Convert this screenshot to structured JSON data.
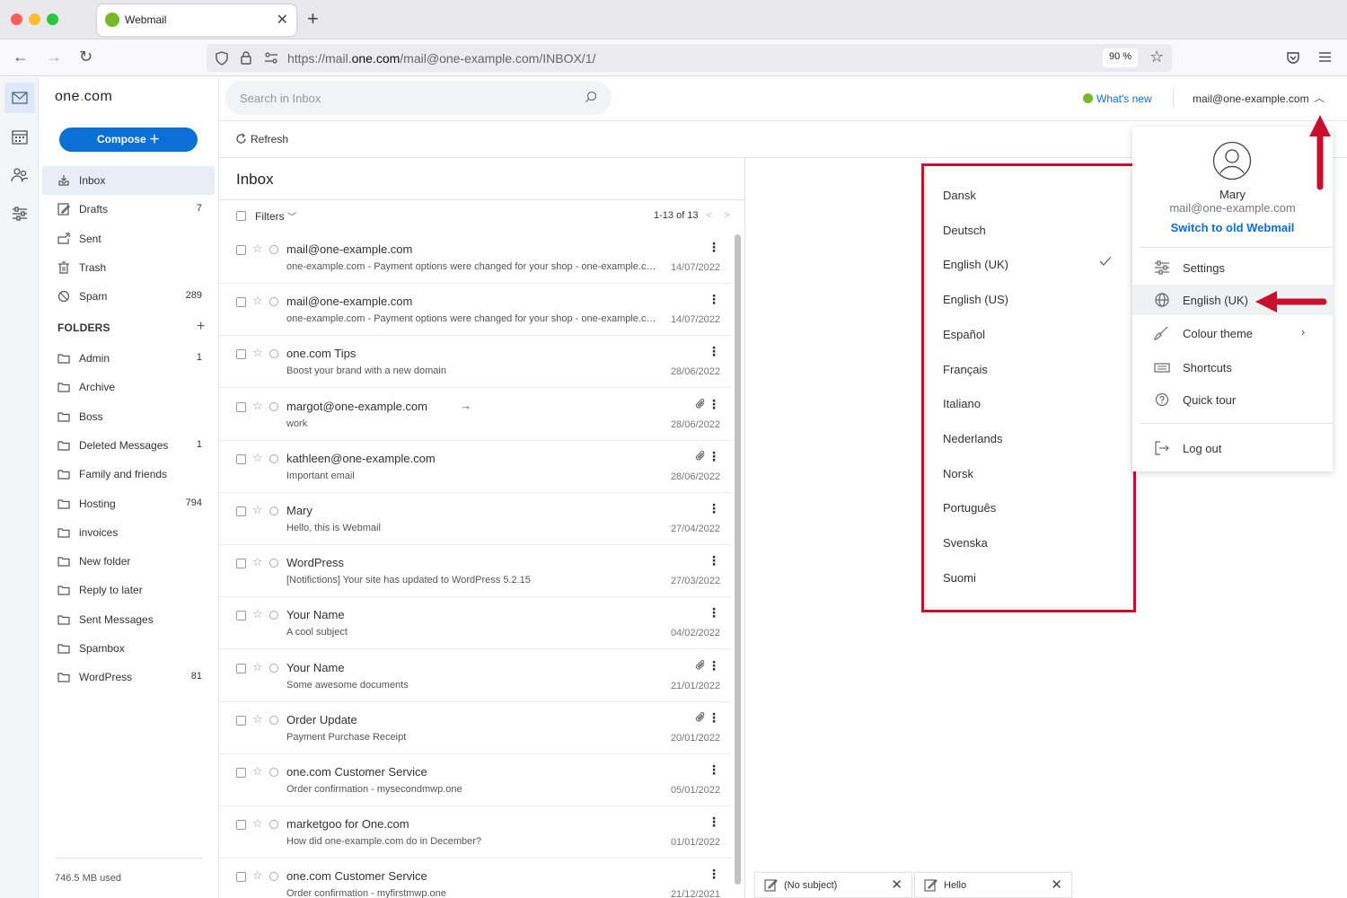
{
  "browser": {
    "tab_title": "Webmail",
    "url_host_prefix": "https://mail.",
    "url_host_bold": "one.com",
    "url_path": "/mail@one-example.com/INBOX/1/",
    "zoom": "90 %"
  },
  "app": {
    "logo_before": "one",
    "logo_dot": ".",
    "logo_after": "com",
    "search_placeholder": "Search in Inbox",
    "whats_new": "What's new",
    "account_email": "mail@one-example.com",
    "compose_label": "Compose",
    "refresh_label": "Refresh",
    "storage_used": "746.5 MB used"
  },
  "sidebar": {
    "mailboxes": [
      {
        "label": "Inbox",
        "count": "",
        "icon": "inbox-icon"
      },
      {
        "label": "Drafts",
        "count": "7",
        "icon": "drafts-icon"
      },
      {
        "label": "Sent",
        "count": "",
        "icon": "sent-icon"
      },
      {
        "label": "Trash",
        "count": "",
        "icon": "trash-icon"
      },
      {
        "label": "Spam",
        "count": "289",
        "icon": "spam-icon"
      }
    ],
    "folders_heading": "FOLDERS",
    "folders": [
      {
        "label": "Admin",
        "count": "1"
      },
      {
        "label": "Archive",
        "count": ""
      },
      {
        "label": "Boss",
        "count": ""
      },
      {
        "label": "Deleted Messages",
        "count": "1"
      },
      {
        "label": "Family and friends",
        "count": ""
      },
      {
        "label": "Hosting",
        "count": "794"
      },
      {
        "label": "invoices",
        "count": ""
      },
      {
        "label": "New folder",
        "count": ""
      },
      {
        "label": "Reply to later",
        "count": ""
      },
      {
        "label": "Sent Messages",
        "count": ""
      },
      {
        "label": "Spambox",
        "count": ""
      },
      {
        "label": "WordPress",
        "count": "81"
      }
    ]
  },
  "list": {
    "title": "Inbox",
    "filters_label": "Filters",
    "pager_text": "1-13 of 13",
    "messages": [
      {
        "from": "mail@one-example.com",
        "subject": "one-example.com - Payment options were changed for your shop - one-example.com",
        "date": "14/07/2022",
        "attachment": false,
        "forwarded": false
      },
      {
        "from": "mail@one-example.com",
        "subject": "one-example.com - Payment options were changed for your shop - one-example.com",
        "date": "14/07/2022",
        "attachment": false,
        "forwarded": false
      },
      {
        "from": "one.com Tips",
        "subject": "Boost your brand with a new domain",
        "date": "28/06/2022",
        "attachment": false,
        "forwarded": false
      },
      {
        "from": "margot@one-example.com",
        "subject": "work",
        "date": "28/06/2022",
        "attachment": true,
        "forwarded": true
      },
      {
        "from": "kathleen@one-example.com",
        "subject": "Important email",
        "date": "28/06/2022",
        "attachment": true,
        "forwarded": false
      },
      {
        "from": "Mary",
        "subject": "Hello, this is Webmail",
        "date": "27/04/2022",
        "attachment": false,
        "forwarded": false
      },
      {
        "from": "WordPress",
        "subject": "[Notifictions] Your site has updated to WordPress 5.2.15",
        "date": "27/03/2022",
        "attachment": false,
        "forwarded": false
      },
      {
        "from": "Your Name",
        "subject": "A cool subject",
        "date": "04/02/2022",
        "attachment": false,
        "forwarded": false
      },
      {
        "from": "Your Name",
        "subject": "Some awesome documents",
        "date": "21/01/2022",
        "attachment": true,
        "forwarded": false
      },
      {
        "from": "Order Update",
        "subject": "Payment Purchase Receipt",
        "date": "20/01/2022",
        "attachment": true,
        "forwarded": false
      },
      {
        "from": "one.com Customer Service",
        "subject": "Order confirmation - mysecondmwp.one",
        "date": "05/01/2022",
        "attachment": false,
        "forwarded": false
      },
      {
        "from": "marketgoo for One.com",
        "subject": "How did one-example.com do in December?",
        "date": "01/01/2022",
        "attachment": false,
        "forwarded": false
      },
      {
        "from": "one.com Customer Service",
        "subject": "Order confirmation - myfirstmwp.one",
        "date": "21/12/2021",
        "attachment": false,
        "forwarded": false
      }
    ]
  },
  "language_menu": {
    "options": [
      "Dansk",
      "Deutsch",
      "English (UK)",
      "English (US)",
      "Español",
      "Français",
      "Italiano",
      "Nederlands",
      "Norsk",
      "Português",
      "Svenska",
      "Suomi"
    ],
    "selected": "English (UK)"
  },
  "account_menu": {
    "name": "Mary",
    "email": "mail@one-example.com",
    "switch_label": "Switch to old Webmail",
    "items": [
      {
        "label": "Settings",
        "icon": "sliders-icon"
      },
      {
        "label": "English (UK)",
        "icon": "globe-icon"
      },
      {
        "label": "Colour theme",
        "icon": "brush-icon"
      },
      {
        "label": "Shortcuts",
        "icon": "keyboard-icon"
      },
      {
        "label": "Quick tour",
        "icon": "help-icon"
      }
    ],
    "logout_label": "Log out"
  },
  "drafts_bar": [
    {
      "label": "(No subject)"
    },
    {
      "label": "Hello"
    }
  ],
  "colors": {
    "accent": "#0a6fd6",
    "brand_green": "#76b82a",
    "annotation_red": "#c8102e"
  }
}
